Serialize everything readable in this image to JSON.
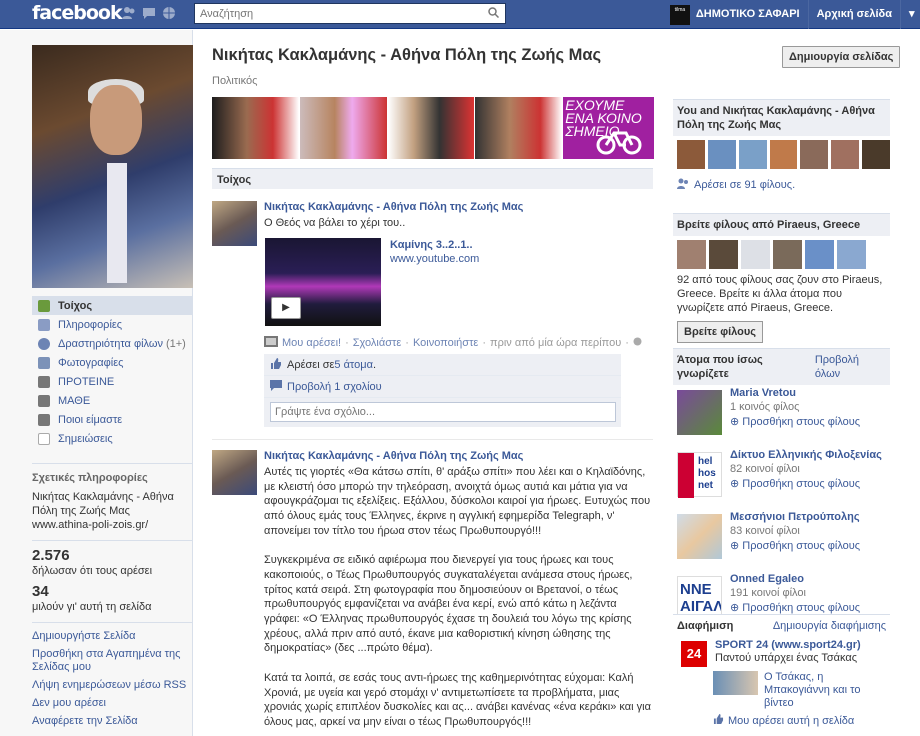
{
  "topbar": {
    "logo": "facebook",
    "search_placeholder": "Αναζήτηση",
    "account_name": "ΔΗΜΟΤΙΚΟ ΣΑΦΑΡΙ",
    "home": "Αρχική σελίδα",
    "nav_thumb_text": "tilma"
  },
  "page": {
    "title": "Νικήτας Κακλαμάνης - Αθήνα Πόλη της Ζωής Μας",
    "category": "Πολιτικός",
    "create_page_button": "Δημιουργία σελίδας",
    "banner_text": "ΕΧΟΥΜΕ ΕΝΑ ΚΟΙΝΟ ΣΗΜΕΙΟ"
  },
  "left_nav": [
    {
      "label": "Τοίχος",
      "selected": true
    },
    {
      "label": "Πληροφορίες"
    },
    {
      "label": "Δραστηριότητα φίλων",
      "count": "(1+)"
    },
    {
      "label": "Φωτογραφίες"
    },
    {
      "label": "ΠΡΟΤΕΙΝΕ"
    },
    {
      "label": "ΜΑΘΕ"
    },
    {
      "label": "Ποιοι είμαστε"
    },
    {
      "label": "Σημειώσεις"
    }
  ],
  "info": {
    "heading": "Σχετικές πληροφορίες",
    "name": "Νικήτας Κακλαμάνης - Αθήνα Πόλη της Ζωής Μας",
    "url": "www.athina-poli-zois.gr/"
  },
  "stats": {
    "likes": "2.576",
    "likes_label": "δήλωσαν ότι τους αρέσει",
    "talking": "34",
    "talking_label": "μιλούν γι' αυτή τη σελίδα"
  },
  "left_links": [
    "Δημιουργήστε Σελίδα",
    "Προσθήκη στα Αγαπημένα της Σελίδας μου",
    "Λήψη ενημερώσεων μέσω RSS",
    "Δεν μου αρέσει",
    "Αναφέρετε την Σελίδα"
  ],
  "wall": {
    "heading": "Τοίχος"
  },
  "post1": {
    "author": "Νικήτας Κακλαμάνης - Αθήνα Πόλη της Ζωής Μας",
    "text": "Ο Θεός να βάλει το χέρι του..",
    "video_title": "Καμίνης 3..2..1..",
    "video_url": "www.youtube.com",
    "like_action": "Μου αρέσει!",
    "comment_action": "Σχολιάστε",
    "share_action": "Κοινοποιήστε",
    "time": "πριν από μία ώρα περίπου",
    "likes_prefix": "Αρέσει σε ",
    "likes_count": "5 άτομα",
    "view_comments": "Προβολή 1 σχολίου",
    "comment_placeholder": "Γράψτε ένα σχόλιο..."
  },
  "post2": {
    "author": "Νικήτας Κακλαμάνης - Αθήνα Πόλη της Ζωής Μας",
    "text": "Αυτές τις γιορτές «Θα κάτσω σπίτι, θ' αράξω σπίτι» που λέει και ο Κηλαϊδόνης, με κλειστή όσο μπορώ την τηλεόραση, ανοιχτά όμως αυτιά και μάτια για να αφουγκράζομαι τις εξελίξεις. Εξάλλου, δύσκολοι καιροί για ήρωες. Ευτυχώς που από όλους εμάς τους Έλληνες, έκρινε η αγγλική εφημερίδα Telegraph, ν' απονείμει τον τίτλο του ήρωα στον τέως Πρωθυπουργό!!!\n\nΣυγκεκριμένα σε ειδικό αφιέρωμα που διενεργεί για τους ήρωες και τους κακοποιούς, ο Τέως Πρωθυπουργός συγκαταλέγεται ανάμεσα στους ήρωες, τρίτος κατά σειρά. Στη φωτογραφία που δημοσιεύουν οι Βρετανοί, ο τέως πρωθυπουργός εμφανίζεται να ανάβει ένα κερί, ενώ από κάτω η λεζάντα γράφει: «Ο Έλληνας πρωθυπουργός έχασε τη δουλειά του λόγω της κρίσης χρέους, αλλά πριν από αυτό, έκανε μια καθοριστική κίνηση ώθησης της δημοκρατίας» (δες ...πρώτο θέμα).\n\nΚατά τα λοιπά, σε εσάς τους αντι-ήρωες της καθημερινότητας εύχομαι: Καλή Χρονιά, με υγεία και γερό στομάχι ν' αντιμετωπίσετε τα προβλήματα, μιας χρονιάς χωρίς επιπλέον δυσκολίες και ας... ανάβει κανένας «ένα κεράκι» και για όλους μας, αρκεί να μην είναι ο τέως Πρωθυπουργός!!!\n\nΚΑΛΗ ΧΡΟΝΙΑ!!!"
  },
  "right": {
    "friends_box_title": "You and Νικήτας Κακλαμάνης - Αθήνα Πόλη της Ζωής Μας",
    "friends_like": "Αρέσει σε 91 φίλους.",
    "find_title": "Βρείτε φίλους από Piraeus, Greece",
    "find_text": "92 από τους φίλους σας ζουν στο Piraeus, Greece. Βρείτε κι άλλα άτομα που γνωρίζετε από Piraeus, Greece.",
    "find_button": "Βρείτε φίλους",
    "pymk_title": "Άτομα που ίσως γνωρίζετε",
    "pymk_all": "Προβολή όλων",
    "pymk": [
      {
        "name": "Maria Vretou",
        "mutual": "1 κοινός φίλος",
        "add": "Προσθήκη στους φίλους",
        "color": "#5a8a3a"
      },
      {
        "name": "Δίκτυο Ελληνικής Φιλοξενίας",
        "mutual": "82 κοινοί φίλοι",
        "add": "Προσθήκη στους φίλους",
        "color": "#1d3f8f"
      },
      {
        "name": "Μεσσήνιοι Πετρούπολης",
        "mutual": "83 κοινοί φίλοι",
        "add": "Προσθήκη στους φίλους",
        "color": "#c9d6e6"
      },
      {
        "name": "Onned Egaleo",
        "mutual": "191 κοινοί φίλοι",
        "add": "Προσθήκη στους φίλους",
        "color": "#1d3f8f"
      }
    ],
    "logo_texts": {
      "heln": "hel hos net",
      "nne": "NNE ΑΙΓΑΛΕ"
    },
    "ads_title": "Διαφήμιση",
    "ads_create": "Δημιουργία διαφήμισης",
    "ad_name": "SPORT 24 (www.sport24.gr)",
    "ad_tagline": "Παντού υπάρχει ένας Τσάκας",
    "ad_logo_text": "24",
    "ad_friend_text": "Ο Τσάκας, η Μπακογιάννη και το βίντεο",
    "ad_like": "Μου αρέσει αυτή η σελίδα"
  }
}
